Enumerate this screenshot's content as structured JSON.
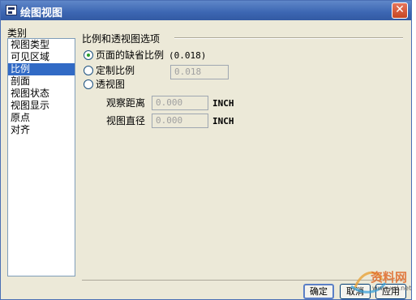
{
  "window": {
    "title": "绘图视图",
    "close_glyph": "✕"
  },
  "categories": {
    "label": "类别",
    "items": [
      "视图类型",
      "可见区域",
      "比例",
      "剖面",
      "视图状态",
      "视图显示",
      "原点",
      "对齐"
    ],
    "selected": "比例"
  },
  "scale_group": {
    "title": "比例和透视图选项",
    "page_default": {
      "label": "页面的缺省比例",
      "value": "(0.018)",
      "checked": true
    },
    "custom": {
      "label": "定制比例",
      "value": "0.018",
      "checked": false
    },
    "perspective": {
      "label": "透视图",
      "checked": false
    },
    "view_distance": {
      "label": "观察距离",
      "value": "0.000",
      "unit": "INCH"
    },
    "view_diameter": {
      "label": "视图直径",
      "value": "0.000",
      "unit": "INCH"
    }
  },
  "buttons": {
    "ok": "确定",
    "cancel": "取消",
    "apply": "应用"
  },
  "watermark": {
    "text": "资料网",
    "url": "www.xsl.net"
  }
}
